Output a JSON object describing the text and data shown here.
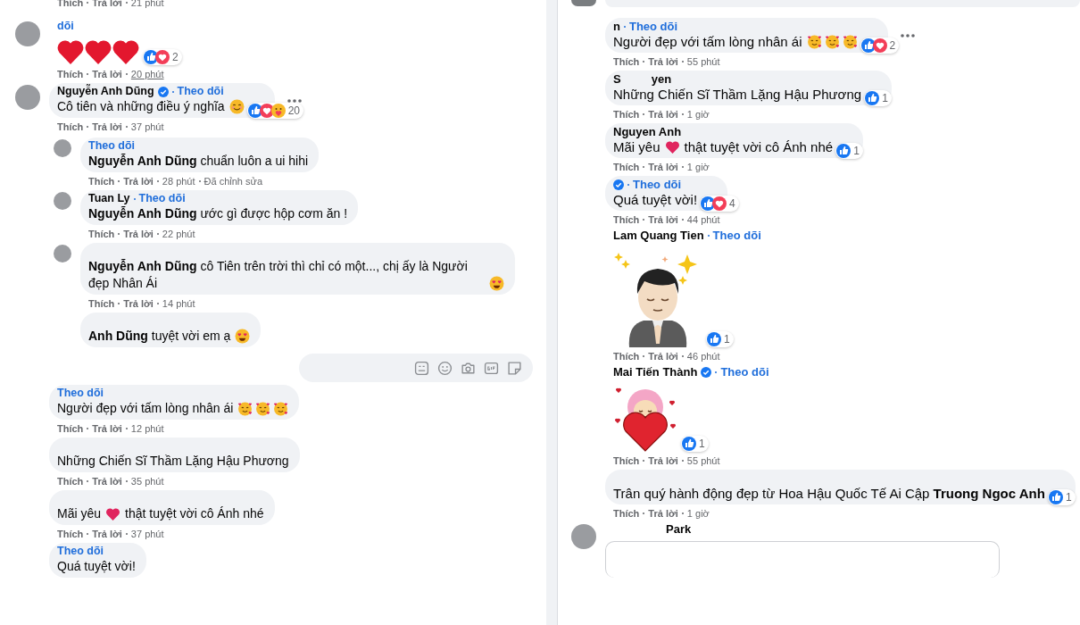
{
  "left_panel": {
    "top_meta": {
      "like": "Thích",
      "reply": "Trả lời",
      "time": "21 phút"
    },
    "comments": [
      {
        "kind": "hearts",
        "avatar": true,
        "follow": "dõi",
        "reactions": {
          "types": [
            {
              "kind": "like"
            },
            {
              "kind": "love"
            }
          ],
          "count": "2"
        },
        "meta": {
          "like": "Thích",
          "reply": "Trả lời",
          "time": "20 phút",
          "underlined": true
        }
      },
      {
        "kind": "text",
        "avatar": true,
        "author": [
          "Nguyễn Anh Dũng"
        ],
        "verified": true,
        "follow": "Theo dõi",
        "body": [
          {
            "kind": "text",
            "text": "Cô tiên và những điều ý nghĩa"
          },
          {
            "kind": "smile"
          }
        ],
        "more": true,
        "reactions": {
          "types": [
            {
              "kind": "like"
            },
            {
              "kind": "love"
            },
            {
              "kind": "care"
            }
          ],
          "count": "20"
        },
        "meta": {
          "like": "Thích",
          "reply": "Trả lời",
          "time": "37 phút"
        },
        "replies": [
          {
            "kind": "text",
            "avatar": true,
            "follow": "Theo dõi",
            "body": [
              {
                "kind": "text",
                "text": "**Nguyễn Anh Dũng** chuẩn luôn a ui hihi"
              }
            ],
            "meta": {
              "like": "Thích",
              "reply": "Trả lời",
              "time": "28 phút",
              "edited": "Đã chỉnh sửa"
            }
          },
          {
            "kind": "text",
            "avatar": true,
            "author": [
              "Tuan Ly"
            ],
            "follow": "Theo dõi",
            "body": [
              {
                "kind": "text",
                "text": "**Nguyễn Anh Dũng** ước gì được hộp cơm ăn !"
              }
            ],
            "meta": {
              "like": "Thích",
              "reply": "Trả lời",
              "time": "22 phút"
            }
          },
          {
            "kind": "text",
            "avatar": true,
            "body": [
              {
                "kind": "text",
                "text": "**Nguyễn Anh Dũng** cô Tiên trên trời thì chỉ có một..., chị ấy là Người đẹp Nhân Ái"
              },
              {
                "kind": "heart_eyes"
              }
            ],
            "meta": {
              "like": "Thích",
              "reply": "Trả lời",
              "time": "14 phút"
            }
          },
          {
            "kind": "text",
            "avatar": false,
            "body": [
              {
                "kind": "text",
                "text": "**Anh Dũng** tuyệt vời em ạ"
              },
              {
                "kind": "heart_eyes"
              }
            ]
          }
        ],
        "reply_box": true
      },
      {
        "kind": "text",
        "avatar": false,
        "follow": "Theo dõi",
        "body": [
          {
            "kind": "text",
            "text": "Người đẹp với tấm lòng nhân ái"
          },
          {
            "kind": "love_face"
          },
          {
            "kind": "love_face"
          },
          {
            "kind": "love_face"
          }
        ],
        "meta": {
          "like": "Thích",
          "reply": "Trả lời",
          "time": "12 phút"
        }
      },
      {
        "kind": "text",
        "avatar": false,
        "body": [
          {
            "kind": "text",
            "text": "Những Chiến Sĩ Thầm Lặng Hậu Phương"
          }
        ],
        "meta": {
          "like": "Thích",
          "reply": "Trả lời",
          "time": "35 phút"
        }
      },
      {
        "kind": "text",
        "avatar": false,
        "body": [
          {
            "kind": "text",
            "text": "Mãi yêu"
          },
          {
            "kind": "heart"
          },
          {
            "kind": "text",
            "text": "thật tuyệt vời cô Ánh nhé"
          }
        ],
        "meta": {
          "like": "Thích",
          "reply": "Trả lời",
          "time": "37 phút"
        }
      },
      {
        "kind": "text",
        "avatar": false,
        "follow": "Theo dõi",
        "body": [
          {
            "kind": "text",
            "text": "Quá tuyệt vời!"
          }
        ]
      }
    ]
  },
  "right_panel": {
    "cut_off_top": true,
    "comments": [
      {
        "kind": "text",
        "avatar": false,
        "author": [
          "n"
        ],
        "follow": "Theo dõi",
        "body": [
          {
            "kind": "text",
            "text": "Người đẹp với tấm lòng nhân ái"
          },
          {
            "kind": "love_face"
          },
          {
            "kind": "love_face"
          },
          {
            "kind": "love_face"
          }
        ],
        "more": true,
        "reactions": {
          "types": [
            {
              "kind": "like"
            },
            {
              "kind": "love"
            }
          ],
          "count": "2"
        },
        "meta": {
          "like": "Thích",
          "reply": "Trả lời",
          "time": "55 phút"
        }
      },
      {
        "kind": "text",
        "avatar": false,
        "author": [
          "S",
          "yen"
        ],
        "body": [
          {
            "kind": "text",
            "text": "Những Chiến Sĩ Thầm Lặng Hậu Phương"
          }
        ],
        "reactions": {
          "types": [
            {
              "kind": "like"
            }
          ],
          "count": "1"
        },
        "meta": {
          "like": "Thích",
          "reply": "Trả lời",
          "time": "1 giờ"
        }
      },
      {
        "kind": "text",
        "avatar": false,
        "author": [
          "Nguyen Anh"
        ],
        "body": [
          {
            "kind": "text",
            "text": "Mãi yêu"
          },
          {
            "kind": "heart"
          },
          {
            "kind": "text",
            "text": "thật tuyệt vời cô Ánh nhé"
          }
        ],
        "reactions": {
          "types": [
            {
              "kind": "like"
            }
          ],
          "count": "1"
        },
        "meta": {
          "like": "Thích",
          "reply": "Trả lời",
          "time": "1 giờ"
        }
      },
      {
        "kind": "text",
        "avatar": false,
        "verified": true,
        "follow": "Theo dõi",
        "body": [
          {
            "kind": "text",
            "text": "Quá tuyệt vời!"
          }
        ],
        "reactions": {
          "types": [
            {
              "kind": "like"
            },
            {
              "kind": "love"
            }
          ],
          "count": "4"
        },
        "meta": {
          "like": "Thích",
          "reply": "Trả lời",
          "time": "44 phút"
        }
      },
      {
        "kind": "prayer_sticker",
        "avatar": false,
        "author": [
          "Lam Quang Tien"
        ],
        "follow": "Theo dõi",
        "reactions": {
          "types": [
            {
              "kind": "like"
            }
          ],
          "count": "1"
        },
        "meta": {
          "like": "Thích",
          "reply": "Trả lời",
          "time": "46 phút"
        }
      },
      {
        "kind": "heart_sticker",
        "avatar": false,
        "author": [
          "Mai Tiến Thành"
        ],
        "verified": true,
        "follow": "Theo dõi",
        "reactions": {
          "types": [
            {
              "kind": "like"
            }
          ],
          "count": "1"
        },
        "meta": {
          "like": "Thích",
          "reply": "Trả lời",
          "time": "55 phút"
        }
      },
      {
        "kind": "text",
        "avatar": false,
        "body": [
          {
            "kind": "text",
            "text": "Trân quý hành động đẹp từ Hoa Hậu Quốc Tế Ai Cập **Truong Ngoc Anh**"
          }
        ],
        "reactions": {
          "types": [
            {
              "kind": "like"
            }
          ],
          "count": "1"
        },
        "meta": {
          "like": "Thích",
          "reply": "Trả lời",
          "time": "1 giờ"
        }
      },
      {
        "kind": "card",
        "avatar": true,
        "author": [
          "Park"
        ]
      }
    ]
  }
}
